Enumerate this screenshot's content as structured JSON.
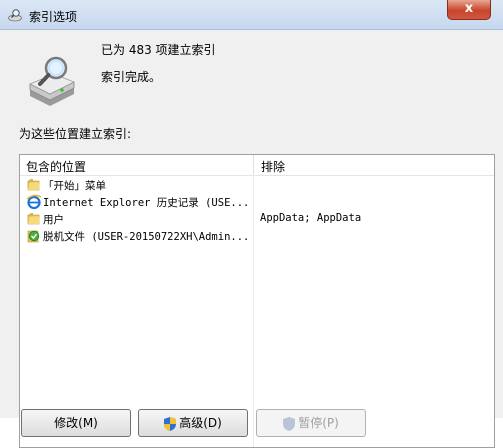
{
  "window": {
    "title": "索引选项",
    "close_glyph": "x"
  },
  "stats": {
    "count_text": "已为 483 项建立索引",
    "status_text": "索引完成。"
  },
  "section_label": "为这些位置建立索引:",
  "list": {
    "headers": {
      "included": "包含的位置",
      "excluded": "排除"
    },
    "rows": [
      {
        "icon": "folder-icon",
        "location": "「开始」菜单",
        "exclude": ""
      },
      {
        "icon": "internet-explorer-icon",
        "location": "Internet Explorer 历史记录 (USE...",
        "exclude": ""
      },
      {
        "icon": "folder-icon",
        "location": "用户",
        "exclude": "AppData; AppData"
      },
      {
        "icon": "offline-files-icon",
        "location": "脱机文件 (USER-20150722XH\\Admin...",
        "exclude": ""
      }
    ]
  },
  "buttons": {
    "modify": "修改(M)",
    "advanced": "高级(D)",
    "pause": "暂停(P)"
  },
  "colors": {
    "window_bg": "#f0f0f0",
    "titlebar": "#c6d7ee",
    "close": "#c7462c"
  }
}
